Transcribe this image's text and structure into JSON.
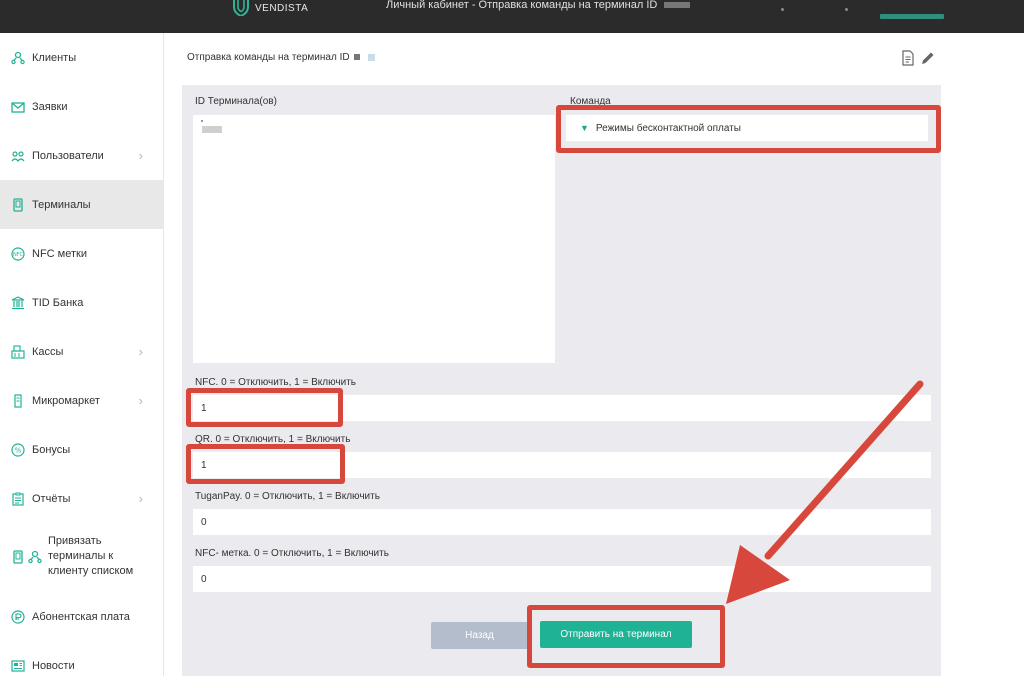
{
  "header": {
    "logo_text": "VENDISTA",
    "title": "Личный кабинет - Отправка команды на терминал ID"
  },
  "sidebar": {
    "items": [
      {
        "label": "Клиенты",
        "icon": "clients-icon",
        "has_submenu": false,
        "active": false
      },
      {
        "label": "Заявки",
        "icon": "envelope-icon",
        "has_submenu": false,
        "active": false
      },
      {
        "label": "Пользователи",
        "icon": "users-icon",
        "has_submenu": true,
        "active": false
      },
      {
        "label": "Терминалы",
        "icon": "terminal-icon",
        "has_submenu": false,
        "active": true
      },
      {
        "label": "NFC метки",
        "icon": "nfc-icon",
        "has_submenu": false,
        "active": false
      },
      {
        "label": "TID Банка",
        "icon": "bank-icon",
        "has_submenu": false,
        "active": false
      },
      {
        "label": "Кассы",
        "icon": "cash-register-icon",
        "has_submenu": true,
        "active": false
      },
      {
        "label": "Микромаркет",
        "icon": "micromarket-icon",
        "has_submenu": true,
        "active": false
      },
      {
        "label": "Бонусы",
        "icon": "bonus-icon",
        "has_submenu": false,
        "active": false
      },
      {
        "label": "Отчёты",
        "icon": "report-icon",
        "has_submenu": true,
        "active": false
      },
      {
        "label": "Привязать терминалы к клиенту списком",
        "icon": "link-terminals-icon",
        "has_submenu": false,
        "active": false
      },
      {
        "label": "Абонентская плата",
        "icon": "subscription-icon",
        "has_submenu": false,
        "active": false
      },
      {
        "label": "Новости",
        "icon": "news-icon",
        "has_submenu": false,
        "active": false
      }
    ]
  },
  "main": {
    "page_title": "Отправка команды на терминал ID",
    "terminal_ids_label": "ID Терминала(ов)",
    "command_label": "Команда",
    "command_value": "Режимы бесконтактной оплаты",
    "params": [
      {
        "label": "NFC. 0 = Отключить, 1 = Включить",
        "value": "1"
      },
      {
        "label": "QR. 0 = Отключить, 1 = Включить",
        "value": "1"
      },
      {
        "label": "TuganPay. 0 = Отключить, 1 = Включить",
        "value": "0"
      },
      {
        "label": "NFC- метка. 0 = Отключить, 1 = Включить",
        "value": "0"
      }
    ],
    "back_button": "Назад",
    "send_button": "Отправить на терминал"
  },
  "colors": {
    "accent": "#20b294",
    "annotation": "#d8473c",
    "header_bg": "#2b2b2b",
    "panel_bg": "#ebebef"
  }
}
